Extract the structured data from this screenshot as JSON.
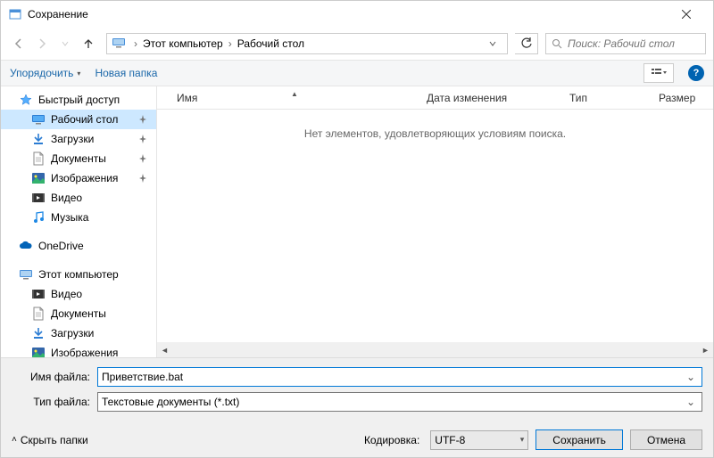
{
  "window": {
    "title": "Сохранение"
  },
  "nav": {
    "breadcrumb": [
      "Этот компьютер",
      "Рабочий стол"
    ],
    "search_placeholder": "Поиск: Рабочий стол"
  },
  "toolbar": {
    "organize": "Упорядочить",
    "new_folder": "Новая папка"
  },
  "sidebar": {
    "quick_access": "Быстрый доступ",
    "quick_items": [
      {
        "label": "Рабочий стол",
        "icon": "desktop",
        "pinned": true,
        "selected": true
      },
      {
        "label": "Загрузки",
        "icon": "downloads",
        "pinned": true
      },
      {
        "label": "Документы",
        "icon": "documents",
        "pinned": true
      },
      {
        "label": "Изображения",
        "icon": "pictures",
        "pinned": true
      },
      {
        "label": "Видео",
        "icon": "videos"
      },
      {
        "label": "Музыка",
        "icon": "music"
      }
    ],
    "onedrive": "OneDrive",
    "this_pc": "Этот компьютер",
    "pc_items": [
      {
        "label": "Видео",
        "icon": "videos"
      },
      {
        "label": "Документы",
        "icon": "documents"
      },
      {
        "label": "Загрузки",
        "icon": "downloads"
      },
      {
        "label": "Изображения",
        "icon": "pictures"
      }
    ]
  },
  "columns": {
    "name": "Имя",
    "date": "Дата изменения",
    "type": "Тип",
    "size": "Размер"
  },
  "content": {
    "empty_message": "Нет элементов, удовлетворяющих условиям поиска."
  },
  "form": {
    "filename_label": "Имя файла:",
    "filename_value": "Приветствие.bat",
    "filetype_label": "Тип файла:",
    "filetype_value": "Текстовые документы (*.txt)"
  },
  "footer": {
    "hide_folders": "Скрыть папки",
    "encoding_label": "Кодировка:",
    "encoding_value": "UTF-8",
    "save": "Сохранить",
    "cancel": "Отмена"
  }
}
